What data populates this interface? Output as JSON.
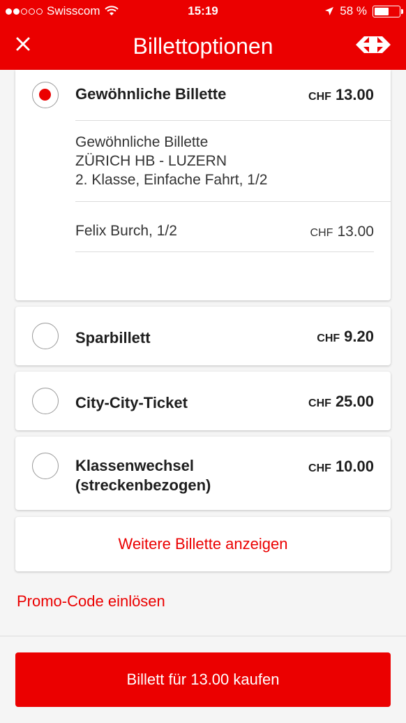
{
  "status": {
    "carrier": "Swisscom",
    "time": "15:19",
    "battery": "58 %",
    "signal_dots_filled": 2,
    "signal_dots_total": 5,
    "battery_level": 0.58
  },
  "nav": {
    "title": "Billettoptionen",
    "close_icon": "close-icon",
    "logo": "sbb-logo"
  },
  "options": [
    {
      "name": "Gewöhnliche Billette",
      "currency": "CHF",
      "price": "13.00",
      "selected": true,
      "details": [
        "Gewöhnliche Billette",
        "ZÜRICH HB - LUZERN",
        "2. Klasse, Einfache Fahrt, 1/2"
      ],
      "passenger": {
        "name": "Felix Burch, 1/2",
        "currency": "CHF",
        "price": "13.00"
      }
    },
    {
      "name": "Sparbillett",
      "currency": "CHF",
      "price": "9.20",
      "selected": false
    },
    {
      "name": "City-City-Ticket",
      "currency": "CHF",
      "price": "25.00",
      "selected": false
    },
    {
      "name_line1": "Klassenwechsel",
      "name_line2": "(streckenbezogen)",
      "currency": "CHF",
      "price": "10.00",
      "selected": false
    }
  ],
  "more_tickets_label": "Weitere Billette anzeigen",
  "promo_label": "Promo-Code einlösen",
  "buy_label": "Billett für 13.00 kaufen",
  "colors": {
    "brand_red": "#eb0000",
    "background": "#f5f5f5"
  }
}
